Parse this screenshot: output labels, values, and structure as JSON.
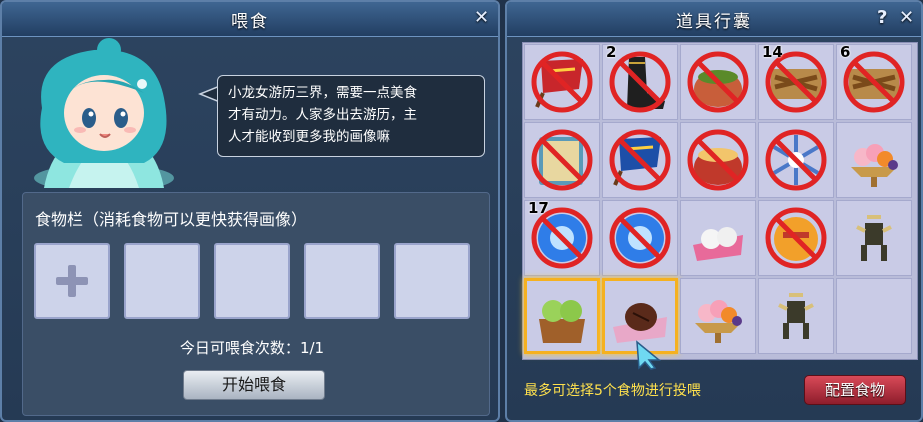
{
  "feed_window": {
    "title": "喂食",
    "close_label": "✕",
    "speech_lines": [
      "小龙女游历三界，需要一点美食",
      "才有动力。人家多出去游历，主",
      "人才能收到更多我的画像嘛"
    ],
    "food_bar_title": "食物栏（消耗食物可以更快获得画像）",
    "slots": [
      "add",
      "empty",
      "empty",
      "empty",
      "empty"
    ],
    "daily_feed_label": "今日可喂食次数：",
    "daily_feed_count": "1/1",
    "start_button": "开始喂食"
  },
  "bag_window": {
    "title": "道具行囊",
    "help_label": "?",
    "close_label": "✕",
    "items": [
      {
        "icon": "red-flag-scroll-icon",
        "qty": "",
        "forbidden": true
      },
      {
        "icon": "black-boot-icon",
        "qty": "2",
        "forbidden": true
      },
      {
        "icon": "herb-bowl-icon",
        "qty": "",
        "forbidden": true
      },
      {
        "icon": "skewer-tray-icon",
        "qty": "14",
        "forbidden": true
      },
      {
        "icon": "skewer-tray-icon",
        "qty": "6",
        "forbidden": true
      },
      {
        "icon": "magic-book-icon",
        "qty": "",
        "forbidden": true
      },
      {
        "icon": "blue-flag-scroll-icon",
        "qty": "",
        "forbidden": true
      },
      {
        "icon": "soup-bowl-icon",
        "qty": "",
        "forbidden": true
      },
      {
        "icon": "snowflake-icon",
        "qty": "",
        "forbidden": true
      },
      {
        "icon": "fruit-platter-icon",
        "qty": "",
        "forbidden": false
      },
      {
        "icon": "blue-orb-icon",
        "qty": "17",
        "forbidden": true
      },
      {
        "icon": "blue-orb-icon",
        "qty": "",
        "forbidden": true
      },
      {
        "icon": "rice-ball-icon",
        "qty": "",
        "forbidden": false
      },
      {
        "icon": "orange-cake-icon",
        "qty": "",
        "forbidden": true
      },
      {
        "icon": "bronze-vessel-icon",
        "qty": "",
        "forbidden": false
      },
      {
        "icon": "green-dumpling-box-icon",
        "qty": "",
        "forbidden": false,
        "selected": true
      },
      {
        "icon": "roasted-chestnut-icon",
        "qty": "",
        "forbidden": false,
        "selected": true
      },
      {
        "icon": "fruit-platter-icon",
        "qty": "",
        "forbidden": false
      },
      {
        "icon": "bronze-vessel-icon",
        "qty": "",
        "forbidden": false
      },
      {
        "icon": "",
        "qty": "",
        "forbidden": false
      }
    ],
    "hint": "最多可选择5个食物进行投喂",
    "config_button": "配置食物"
  },
  "colors": {
    "panel_bg": "#2d4460",
    "title_bar": "#3f6692",
    "slot_bg": "#cdd3ea",
    "hint_yellow": "#ffe14d",
    "config_red": "#c83545",
    "selected_border": "#f5b120"
  }
}
